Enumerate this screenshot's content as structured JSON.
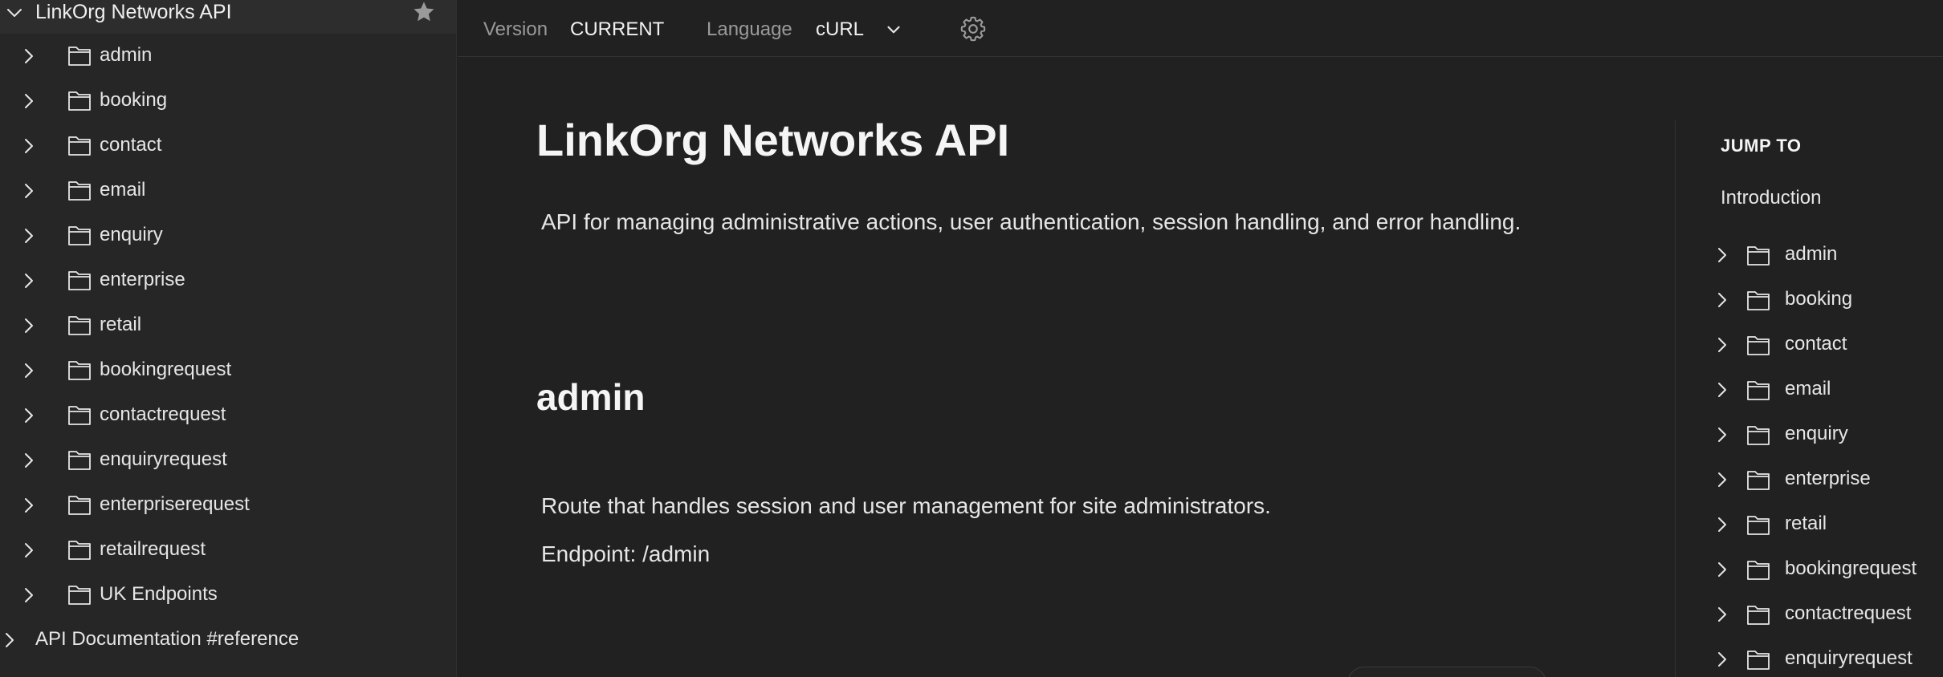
{
  "sidebar": {
    "collection": {
      "name": "LinkOrg Networks API",
      "expand_icon": "chevron-down-icon",
      "favorite_icon": "star-icon"
    },
    "items": [
      {
        "label": "admin"
      },
      {
        "label": "booking"
      },
      {
        "label": "contact"
      },
      {
        "label": "email"
      },
      {
        "label": "enquiry"
      },
      {
        "label": "enterprise"
      },
      {
        "label": "retail"
      },
      {
        "label": "bookingrequest"
      },
      {
        "label": "contactrequest"
      },
      {
        "label": "enquiryrequest"
      },
      {
        "label": "enterpriserequest"
      },
      {
        "label": "retailrequest"
      },
      {
        "label": "UK Endpoints"
      }
    ],
    "reference": {
      "label": "API Documentation #reference"
    }
  },
  "topbar": {
    "version_label": "Version",
    "version_value": "CURRENT",
    "language_label": "Language",
    "language_value": "cURL",
    "settings_icon": "gear-icon"
  },
  "main": {
    "title": "LinkOrg Networks API",
    "description": "API for managing administrative actions, user authentication, session handling, and error handling.",
    "section": {
      "title": "admin",
      "description": "Route that handles session and user management for site administrators.",
      "endpoint": "Endpoint: /admin"
    }
  },
  "jump_to": {
    "heading": "JUMP TO",
    "intro": "Introduction",
    "items": [
      {
        "label": "admin"
      },
      {
        "label": "booking"
      },
      {
        "label": "contact"
      },
      {
        "label": "email"
      },
      {
        "label": "enquiry"
      },
      {
        "label": "enterprise"
      },
      {
        "label": "retail"
      },
      {
        "label": "bookingrequest"
      },
      {
        "label": "contactrequest"
      },
      {
        "label": "enquiryrequest"
      }
    ]
  },
  "colors": {
    "background": "#212121",
    "sidebar": "#262626",
    "selected_row": "#2d2d2d",
    "text": "#e6e6e6",
    "muted": "#9a9a9a"
  }
}
